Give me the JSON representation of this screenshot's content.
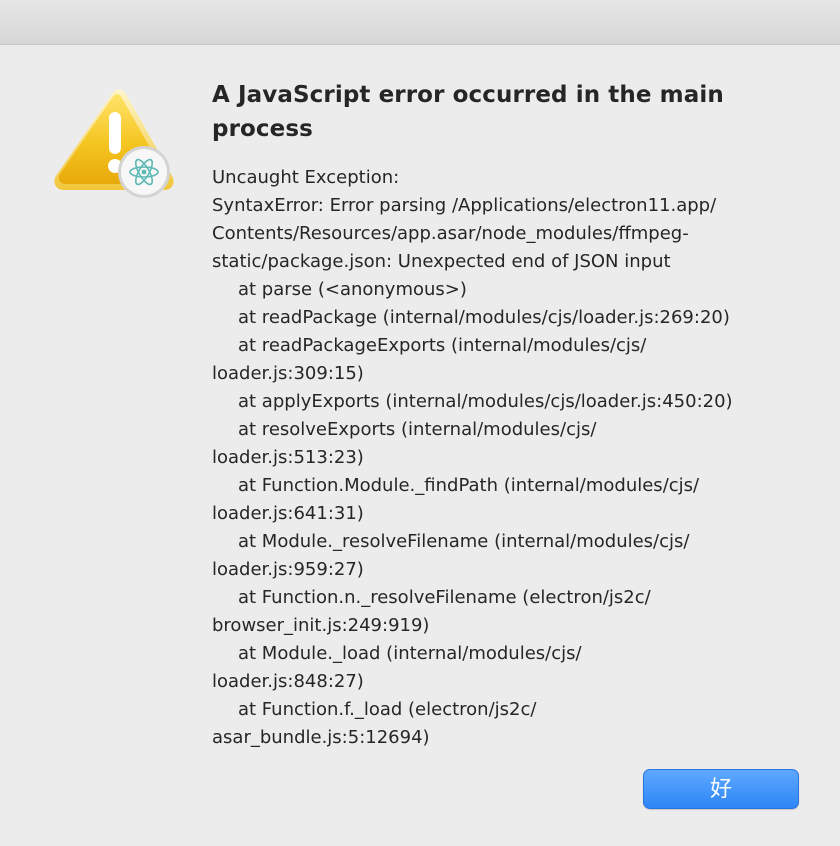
{
  "dialog": {
    "title": "A JavaScript error occurred in the main process",
    "icon": "warning-icon",
    "badge_icon": "electron-icon",
    "message_lines": [
      {
        "text": "Uncaught Exception:",
        "indent": false
      },
      {
        "text": "SyntaxError: Error parsing /Applications/electron11.app/",
        "indent": false
      },
      {
        "text": "Contents/Resources/app.asar/node_modules/ffmpeg-",
        "indent": false
      },
      {
        "text": "static/package.json: Unexpected end of JSON input",
        "indent": false
      },
      {
        "text": "at parse (<anonymous>)",
        "indent": true
      },
      {
        "text": "at readPackage (internal/modules/cjs/loader.js:269:20)",
        "indent": true
      },
      {
        "text": "at readPackageExports (internal/modules/cjs/",
        "indent": true
      },
      {
        "text": "loader.js:309:15)",
        "indent": false
      },
      {
        "text": "at applyExports (internal/modules/cjs/loader.js:450:20)",
        "indent": true
      },
      {
        "text": "at resolveExports (internal/modules/cjs/",
        "indent": true
      },
      {
        "text": "loader.js:513:23)",
        "indent": false
      },
      {
        "text": "at Function.Module._findPath (internal/modules/cjs/",
        "indent": true
      },
      {
        "text": "loader.js:641:31)",
        "indent": false
      },
      {
        "text": "at Module._resolveFilename (internal/modules/cjs/",
        "indent": true
      },
      {
        "text": "loader.js:959:27)",
        "indent": false
      },
      {
        "text": "at Function.n._resolveFilename (electron/js2c/",
        "indent": true
      },
      {
        "text": "browser_init.js:249:919)",
        "indent": false
      },
      {
        "text": "at Module._load (internal/modules/cjs/",
        "indent": true
      },
      {
        "text": "loader.js:848:27)",
        "indent": false
      },
      {
        "text": "at Function.f._load (electron/js2c/",
        "indent": true
      },
      {
        "text": "asar_bundle.js:5:12694)",
        "indent": false
      }
    ],
    "ok_label": "好"
  },
  "colors": {
    "background": "#ececec",
    "text": "#262626",
    "button_blue": "#2c86f6",
    "warning_yellow": "#f2c21b"
  }
}
